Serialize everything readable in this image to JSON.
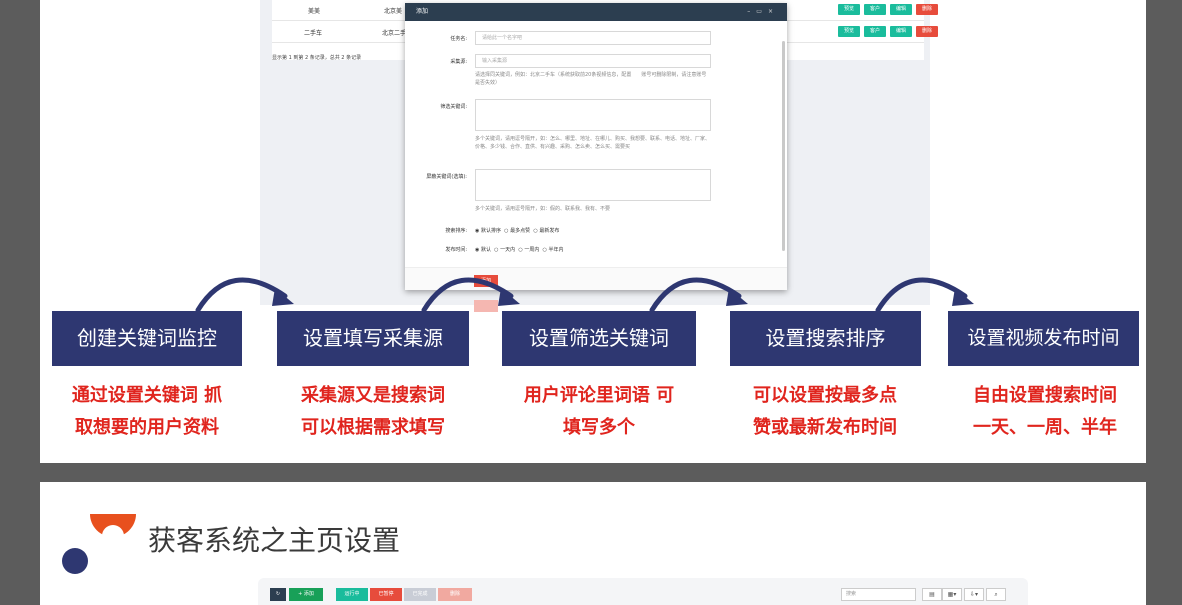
{
  "table": {
    "rows": [
      {
        "name": "美美",
        "source": "北京美"
      },
      {
        "name": "二手车",
        "source": "北京二手"
      }
    ],
    "actions": [
      "预览",
      "客户",
      "编辑",
      "删除"
    ],
    "pager": "显示第 1 到第 2 条记录，总共 2 条记录"
  },
  "dialog": {
    "title": "添加",
    "task_label": "任务名:",
    "task_placeholder": "请给此一个名字吧",
    "source_label": "采集源:",
    "source_placeholder": "输入采集源",
    "source_help": "请选择同关键词，例如：北京二手车（系统获取前20条视频信息，配置　　账号可删除限制，请注意账号是否失效）",
    "filter_label": "筛选关键词:",
    "filter_help": "多个关键词，请用逗号隔开，如：怎么、哪里、地址、在哪儿、购买、我想要、联系、电话、地址、厂家、价格、多少钱、合作、直供、有兴趣、采购、怎么卖、怎么买、需要买",
    "exclude_label": "屏蔽关键词(选填):",
    "exclude_help": "多个关键词，请用逗号隔开，如：假的、联系我、我有、不要",
    "sort_label": "搜索排序:",
    "sort_options": [
      "默认排序",
      "最多点赞",
      "最新发布"
    ],
    "time_label": "发布时间:",
    "time_options": [
      "默认",
      "一天内",
      "一周内",
      "半年内"
    ],
    "submit_label": "添加"
  },
  "steps": [
    {
      "title": "创建关键词监控",
      "desc1": "通过设置关键词 抓",
      "desc2": "取想要的用户资料"
    },
    {
      "title": "设置填写采集源",
      "desc1": "采集源又是搜索词",
      "desc2": "可以根据需求填写"
    },
    {
      "title": "设置筛选关键词",
      "desc1": "用户评论里词语 可",
      "desc2": "填写多个"
    },
    {
      "title": "设置搜索排序",
      "desc1": "可以设置按最多点",
      "desc2": "赞或最新发布时间"
    },
    {
      "title": "设置视频发布时间",
      "desc1": "自由设置搜索时间",
      "desc2": "一天、一周、半年"
    }
  ],
  "slide2": {
    "title": "获客系统之主页设置",
    "toolbar": {
      "refresh": "↻",
      "add": "+ 添加",
      "running": "运行中",
      "paused": "已暂停",
      "stopped": "已完成",
      "delete": "删除",
      "search_placeholder": "搜索",
      "view_icons": [
        "▤",
        "▦▾",
        "⇩▾",
        "⌕"
      ]
    }
  },
  "colors": {
    "step_bg": "#2e3771",
    "desc_text": "#e0251e",
    "accent_green": "#1abc9c",
    "accent_red": "#e74c3c",
    "logo_orange": "#e8501e",
    "logo_navy": "#2e3771"
  }
}
